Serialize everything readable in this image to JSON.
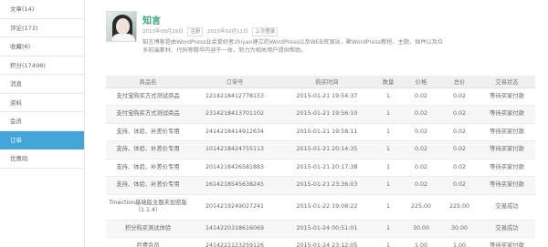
{
  "sidebar": {
    "items": [
      {
        "label": "文章(14)",
        "active": false
      },
      {
        "label": "评论(173)",
        "active": false
      },
      {
        "label": "收藏(6)",
        "active": false
      },
      {
        "label": "积分(17498)",
        "active": false
      },
      {
        "label": "消息",
        "active": false
      },
      {
        "label": "资料",
        "active": false
      },
      {
        "label": "会员",
        "active": false
      },
      {
        "label": "订单",
        "active": true
      },
      {
        "label": "优惠码",
        "active": false
      }
    ]
  },
  "profile": {
    "username": "知言",
    "register_date": "2013年09月29日",
    "register_tag": "注册",
    "last_login_date": "2015年02月11日",
    "last_login_tag": "上次登录",
    "bio": "知言博客是由WordPress业余爱好者zhiyan建立的WordPress以及WEB资源站，聚WordPress教程、主题、插件以及众多前端素材、代码等精华内容于一体，努力为相关用户提供帮助。"
  },
  "orders": {
    "headers": [
      "商品名",
      "订单号",
      "购买时间",
      "数量",
      "价格",
      "总价",
      "交易状态"
    ],
    "rows": [
      [
        "支付宝购买方式测试商品",
        "1214218412778153",
        "2015-01-21 19:54:37",
        "1",
        "0.02",
        "0.02",
        "等待买家付款"
      ],
      [
        "支付宝购买方式测试商品",
        "2314218413701102",
        "2015-01-21 19:56:10",
        "1",
        "0.02",
        "0.02",
        "等待买家付款"
      ],
      [
        "支持、体验、补差价专用",
        "2414218414912634",
        "2015-01-21 19:58:11",
        "1",
        "0.02",
        "0.02",
        "等待买家付款"
      ],
      [
        "支持、体验、补差价专用",
        "1014218424755113",
        "2015-01-21 20:14:35",
        "1",
        "0.02",
        "0.02",
        "等待买家付款"
      ],
      [
        "支持、体验、补差价专用",
        "2014218426581883",
        "2015-01-21 20:17:38",
        "1",
        "0.02",
        "0.02",
        "等待买家付款"
      ],
      [
        "支持、体验、补差价专用",
        "1614218545638245",
        "2015-01-21 23:36:03",
        "1",
        "0.02",
        "0.02",
        "等待买家付款"
      ],
      [
        "Tinection基础版主题未加密版（1.1.4）",
        "2014219249027241",
        "2015-01-22 19:08:22",
        "1",
        "225.00",
        "225.00",
        "交易成功"
      ],
      [
        "积分购买测试体验",
        "1414220318616069",
        "2015-01-24 00:51:01",
        "1",
        "30.00",
        "30.00",
        "交易成功"
      ],
      [
        "月费会员",
        "2414221123259126",
        "2015-01-24 23:12:05",
        "1",
        "1.00",
        "1.00",
        "等待买家付款"
      ]
    ]
  }
}
